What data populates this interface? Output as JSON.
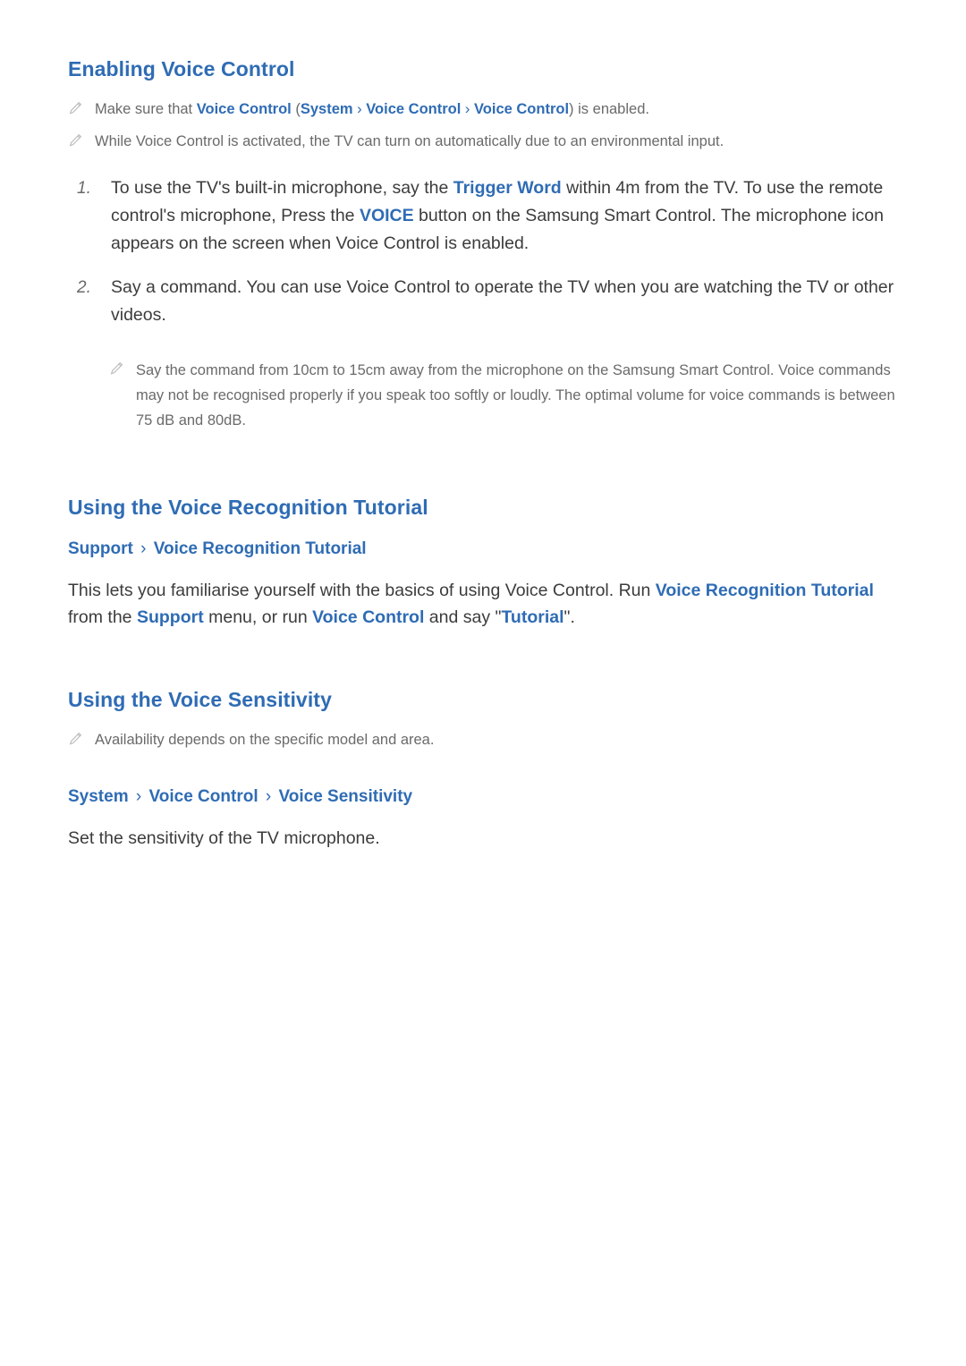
{
  "sections": {
    "enabling": {
      "title": "Enabling Voice Control",
      "note1": {
        "pre": "Make sure that ",
        "b1": "Voice Control",
        "paren_open": " (",
        "b2": "System",
        "chev1": "›",
        "b3": "Voice Control",
        "chev2": "›",
        "b4": "Voice Control",
        "paren_close": ") ",
        "post": "is enabled."
      },
      "note2": "While Voice Control is activated, the TV can turn on automatically due to an environmental input.",
      "step1": {
        "num": "1.",
        "t1": "To use the TV's built-in microphone, say the ",
        "b1": "Trigger Word",
        "t2": " within 4m from the TV. To use the remote control's microphone, Press the ",
        "b2": "VOICE",
        "t3": " button on the Samsung Smart Control. The microphone icon appears on the screen when Voice Control is enabled."
      },
      "step2": {
        "num": "2.",
        "t1": "Say a command. You can use Voice Control to operate the TV when you are watching the TV or other videos."
      },
      "subnote": "Say the command from 10cm to 15cm away from the microphone on the Samsung Smart Control. Voice commands may not be recognised properly if you speak too softly or loudly. The optimal volume for voice commands is between 75 dB and 80dB."
    },
    "tutorial": {
      "title": "Using the Voice Recognition Tutorial",
      "path": {
        "p1": "Support",
        "chev": "›",
        "p2": "Voice Recognition Tutorial"
      },
      "body": {
        "t1": "This lets you familiarise yourself with the basics of using Voice Control. Run ",
        "b1": "Voice Recognition Tutorial",
        "t2": " from the ",
        "b2": "Support",
        "t3": " menu, or run ",
        "b3": "Voice Control",
        "t4": " and say \"",
        "b4": "Tutorial",
        "t5": "\"."
      }
    },
    "sensitivity": {
      "title": "Using the Voice Sensitivity",
      "note": "Availability depends on the specific model and area.",
      "path": {
        "p1": "System",
        "chev1": "›",
        "p2": "Voice Control",
        "chev2": "›",
        "p3": "Voice Sensitivity"
      },
      "body": "Set the sensitivity of the TV microphone."
    }
  },
  "icons": {
    "pencil": "pencil-icon"
  },
  "colors": {
    "accent": "#2f6cb4",
    "body": "#3c3c3c",
    "muted": "#6a6a6a",
    "icon": "#b9b9b9"
  }
}
